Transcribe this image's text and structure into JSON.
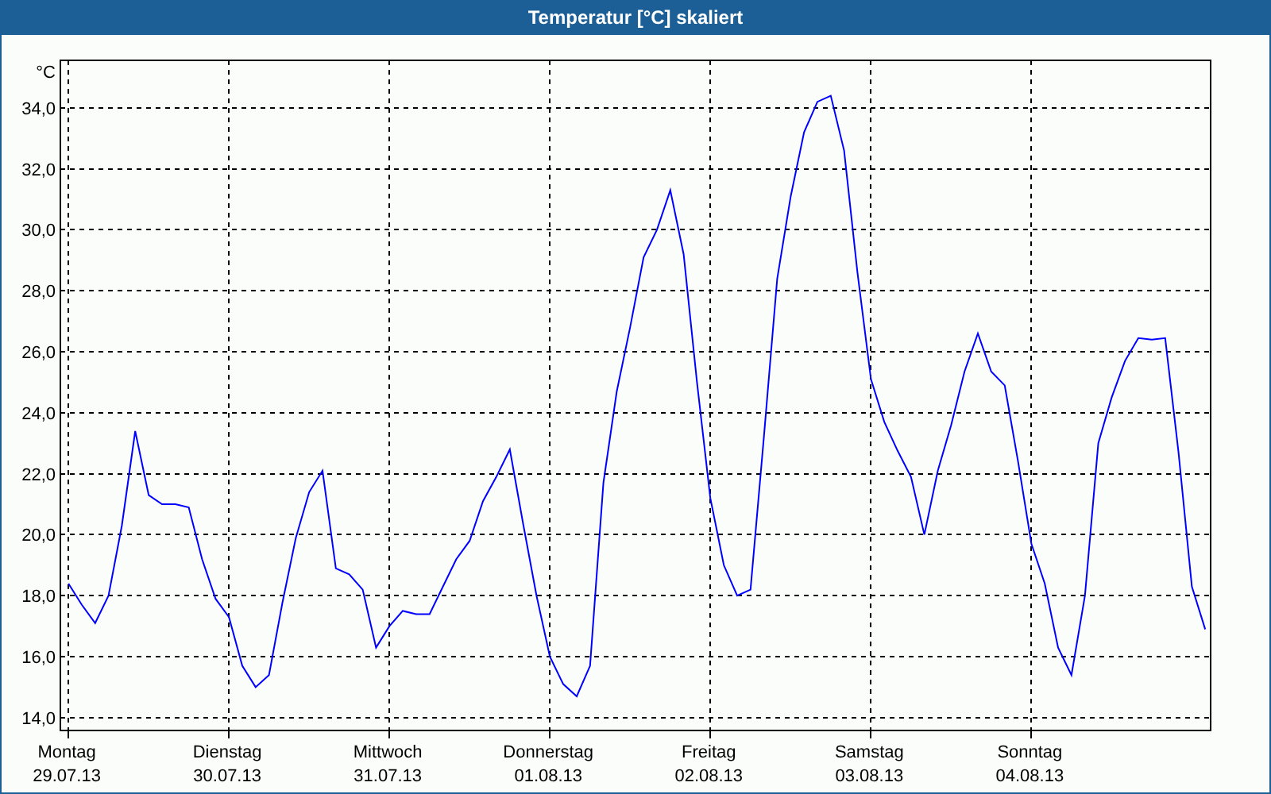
{
  "window": {
    "title": "Temperatur [°C] skaliert"
  },
  "chart_data": {
    "type": "line",
    "ylabel": "°C",
    "grid": true,
    "ylim": [
      13.58,
      35.56
    ],
    "categories": [
      "Montag\n29.07.13",
      null,
      null,
      null,
      null,
      null,
      null,
      null,
      null,
      null,
      null,
      null,
      "Dienstag\n30.07.13",
      null,
      null,
      null,
      null,
      null,
      null,
      null,
      null,
      null,
      null,
      null,
      "Mittwoch\n31.07.13",
      null,
      null,
      null,
      null,
      null,
      null,
      null,
      null,
      null,
      null,
      null,
      "Donnerstag\n01.08.13",
      null,
      null,
      null,
      null,
      null,
      null,
      null,
      null,
      null,
      null,
      null,
      "Freitag\n02.08.13",
      null,
      null,
      null,
      null,
      null,
      null,
      null,
      null,
      null,
      null,
      null,
      "Samstag\n03.08.13",
      null,
      null,
      null,
      null,
      null,
      null,
      null,
      null,
      null,
      null,
      null,
      "Sonntag\n04.08.13",
      null,
      null,
      null,
      null,
      null,
      null,
      null,
      null,
      null,
      null,
      null,
      null,
      null
    ],
    "yticks": [
      {
        "value": 14,
        "label": "14,0"
      },
      {
        "value": 16,
        "label": "16,0"
      },
      {
        "value": 18,
        "label": "18,0"
      },
      {
        "value": 20,
        "label": "20,0"
      },
      {
        "value": 22,
        "label": "22,0"
      },
      {
        "value": 24,
        "label": "24,0"
      },
      {
        "value": 26,
        "label": "26,0"
      },
      {
        "value": 28,
        "label": "28,0"
      },
      {
        "value": 30,
        "label": "30,0"
      },
      {
        "value": 32,
        "label": "32,0"
      },
      {
        "value": 34,
        "label": "34,0"
      }
    ],
    "series": [
      {
        "color": "#0000ff",
        "values": [
          18.4,
          17.7,
          17.1,
          18.0,
          20.3,
          23.4,
          21.3,
          21.0,
          21.0,
          20.9,
          19.2,
          17.9,
          17.3,
          15.7,
          15.0,
          15.4,
          17.75,
          19.9,
          21.4,
          22.1,
          18.9,
          18.7,
          18.2,
          16.3,
          17.0,
          17.5,
          17.4,
          17.4,
          18.3,
          19.2,
          19.8,
          21.1,
          21.9,
          22.8,
          20.35,
          18.0,
          16.0,
          15.1,
          14.7,
          15.7,
          21.7,
          24.7,
          26.8,
          29.1,
          30.0,
          31.3,
          29.2,
          25.0,
          21.2,
          19.0,
          18.0,
          18.2,
          23.2,
          28.4,
          31.1,
          33.2,
          34.2,
          34.4,
          32.6,
          28.6,
          25.1,
          23.7,
          22.75,
          21.9,
          20.0,
          22.1,
          23.6,
          25.35,
          26.6,
          25.35,
          24.9,
          22.4,
          19.7,
          18.4,
          16.3,
          15.4,
          18.0,
          23.0,
          24.5,
          25.7,
          26.45,
          26.4,
          26.45,
          22.7,
          18.3,
          16.9
        ]
      }
    ]
  }
}
